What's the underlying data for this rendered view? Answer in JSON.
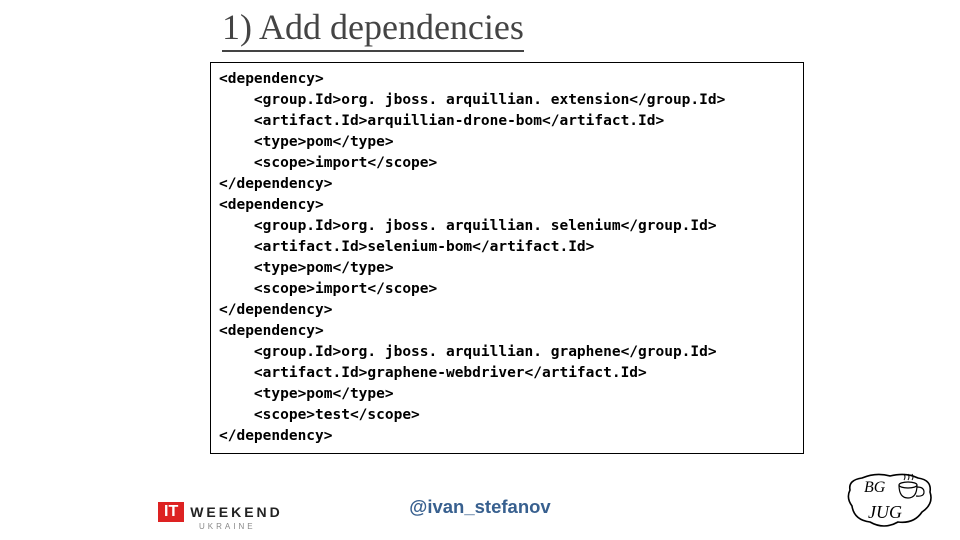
{
  "title": "1) Add dependencies",
  "handle": "@ivan_stefanov",
  "logo_it": {
    "badge": "IT",
    "text": "WEEKEND",
    "sub": "UKRAINE"
  },
  "logo_bgjug": {
    "top": "BG",
    "bottom": "JUG"
  },
  "dependencies": [
    {
      "groupId": "org. jboss. arquillian. extension",
      "artifactId": "arquillian-drone-bom",
      "type": "pom",
      "scope": "import"
    },
    {
      "groupId": "org. jboss. arquillian. selenium",
      "artifactId": "selenium-bom",
      "type": "pom",
      "scope": "import"
    },
    {
      "groupId": "org. jboss. arquillian. graphene",
      "artifactId": "graphene-webdriver",
      "type": "pom",
      "scope": "test"
    }
  ],
  "code_lines": [
    "<dependency>",
    "    <group.Id>org. jboss. arquillian. extension</group.Id>",
    "    <artifact.Id>arquillian-drone-bom</artifact.Id>",
    "    <type>pom</type>",
    "    <scope>import</scope>",
    "</dependency>",
    "<dependency>",
    "    <group.Id>org. jboss. arquillian. selenium</group.Id>",
    "    <artifact.Id>selenium-bom</artifact.Id>",
    "    <type>pom</type>",
    "    <scope>import</scope>",
    "</dependency>",
    "<dependency>",
    "    <group.Id>org. jboss. arquillian. graphene</group.Id>",
    "    <artifact.Id>graphene-webdriver</artifact.Id>",
    "    <type>pom</type>",
    "    <scope>test</scope>",
    "</dependency>"
  ]
}
